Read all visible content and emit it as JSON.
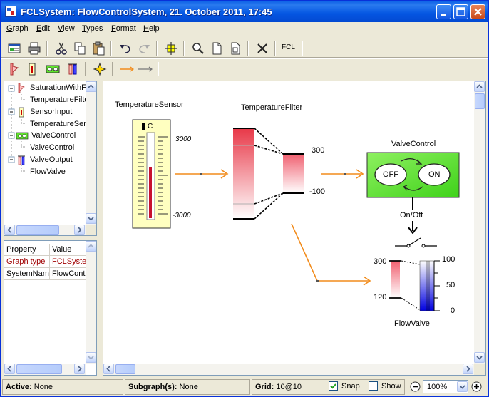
{
  "window": {
    "title": "FCLSystem: FlowControlSystem, 21. October 2011, 17:45"
  },
  "menu": {
    "items": [
      {
        "u": "G",
        "rest": "raph"
      },
      {
        "u": "E",
        "rest": "dit"
      },
      {
        "u": "V",
        "rest": "iew"
      },
      {
        "u": "T",
        "rest": "ypes"
      },
      {
        "u": "F",
        "rest": "ormat"
      },
      {
        "u": "H",
        "rest": "elp"
      }
    ]
  },
  "toolbar": {
    "fcl_label": "FCL"
  },
  "tree": {
    "nodes": [
      {
        "label": "SaturationWithFilter",
        "level": 0,
        "icon": "saturation-icon"
      },
      {
        "label": "TemperatureFilter",
        "level": 1
      },
      {
        "label": "SensorInput",
        "level": 0,
        "icon": "sensor-icon"
      },
      {
        "label": "TemperatureSensor",
        "level": 1
      },
      {
        "label": "ValveControl",
        "level": 0,
        "icon": "valve-control-icon"
      },
      {
        "label": "ValveControl",
        "level": 1
      },
      {
        "label": "ValveOutput",
        "level": 0,
        "icon": "valve-output-icon"
      },
      {
        "label": "FlowValve",
        "level": 1
      }
    ]
  },
  "properties": {
    "headers": [
      "Property",
      "Value"
    ],
    "rows": [
      {
        "property": "Graph type",
        "value": "FCLSystem",
        "highlight": true
      },
      {
        "property": "SystemName",
        "value": "FlowControlSystem",
        "highlight": false
      }
    ]
  },
  "diagram": {
    "sensor": {
      "title": "TemperatureSensor",
      "unit": "C",
      "max": "3000",
      "min": "-3000"
    },
    "filter": {
      "title": "TemperatureFilter",
      "max": "300",
      "min": "-100"
    },
    "control": {
      "title": "ValveControl",
      "off": "OFF",
      "on": "ON",
      "output_label": "On/Off"
    },
    "valve": {
      "title": "FlowValve",
      "in_max": "300",
      "in_min": "120",
      "out_max": "100",
      "out_mid": "50",
      "out_min": "0"
    }
  },
  "status": {
    "active_label": "Active:",
    "active_value": "None",
    "subgraph_label": "Subgraph(s):",
    "subgraph_value": "None",
    "grid_label": "Grid:",
    "grid_value": "10@10",
    "snap_label": "Snap",
    "snap_checked": true,
    "show_label": "Show",
    "show_checked": false,
    "zoom": "100%"
  },
  "colors": {
    "accent_orange": "#f28c1c",
    "control_green": "#5ee62a"
  }
}
